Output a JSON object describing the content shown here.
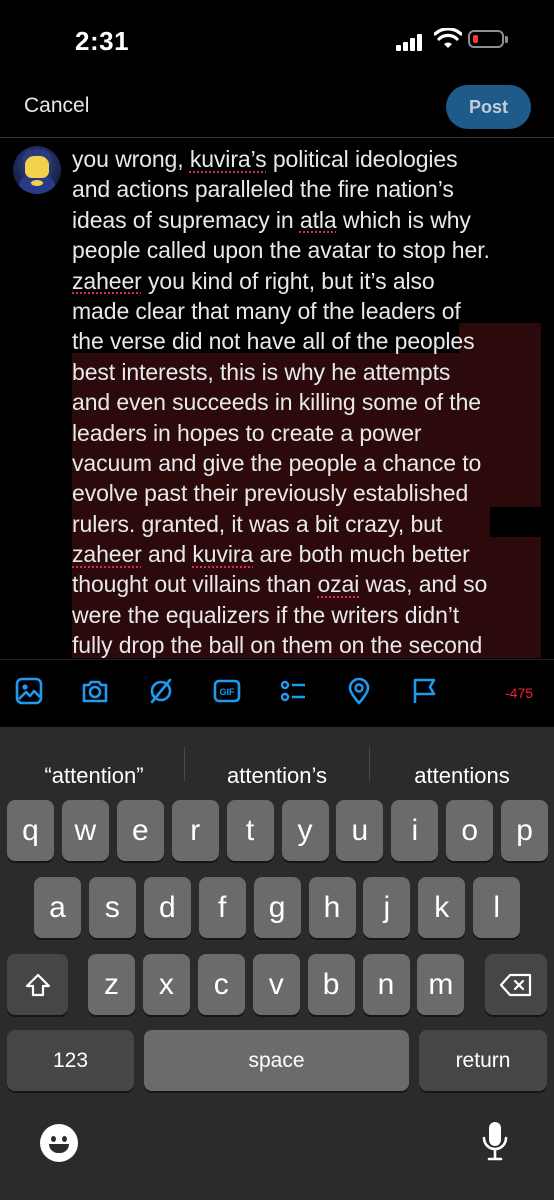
{
  "status_bar": {
    "time": "2:31"
  },
  "header": {
    "cancel_label": "Cancel",
    "post_label": "Post"
  },
  "composer": {
    "text_lines": [
      [
        {
          "t": "you wrong, "
        },
        {
          "t": "kuvira’s",
          "s": 1
        },
        {
          "t": " political ideologies"
        }
      ],
      [
        {
          "t": "and actions paralleled the fire nation’s"
        }
      ],
      [
        {
          "t": "ideas of supremacy in "
        },
        {
          "t": "atla",
          "s": 1
        },
        {
          "t": " which is why"
        }
      ],
      [
        {
          "t": "people called upon the avatar to stop her."
        }
      ],
      [
        {
          "t": "zaheer",
          "s": 1
        },
        {
          "t": " you kind of right, but it’s also"
        }
      ],
      [
        {
          "t": "made clear that many of the leaders of"
        }
      ],
      [
        {
          "t": "the verse did not have all of the peoples"
        }
      ],
      [
        {
          "t": "best interests, this is why he attempts"
        }
      ],
      [
        {
          "t": "and even succeeds in killing some of the"
        }
      ],
      [
        {
          "t": "leaders in hopes to create a power"
        }
      ],
      [
        {
          "t": "vacuum and give the people a chance to"
        }
      ],
      [
        {
          "t": "evolve past their previously established"
        }
      ],
      [
        {
          "t": "rulers. granted, it was a bit crazy, but"
        }
      ],
      [
        {
          "t": "zaheer",
          "s": 1
        },
        {
          "t": " and "
        },
        {
          "t": "kuvira",
          "s": 1
        },
        {
          "t": " are both much better"
        }
      ],
      [
        {
          "t": "thought out villains than "
        },
        {
          "t": "ozai",
          "s": 1
        },
        {
          "t": " was, and so"
        }
      ],
      [
        {
          "t": "were the equalizers if the writers didn’t"
        }
      ],
      [
        {
          "t": "fully drop the ball on them on the second"
        }
      ]
    ],
    "char_count": "-475"
  },
  "toolbar": {
    "icons": [
      "image-icon",
      "camera-icon",
      "gif-icon-slash",
      "gif-icon",
      "poll-icon",
      "location-icon",
      "flag-icon"
    ],
    "gif_label": "GIF"
  },
  "keyboard": {
    "suggestions": [
      "“attention”",
      "attention’s",
      "attentions"
    ],
    "row1": [
      "q",
      "w",
      "e",
      "r",
      "t",
      "y",
      "u",
      "i",
      "o",
      "p"
    ],
    "row2": [
      "a",
      "s",
      "d",
      "f",
      "g",
      "h",
      "j",
      "k",
      "l"
    ],
    "row3": [
      "z",
      "x",
      "c",
      "v",
      "b",
      "n",
      "m"
    ],
    "numbers_label": "123",
    "space_label": "space",
    "return_label": "return"
  },
  "colors": {
    "accent": "#1d9bf0",
    "post_button": "#1e5a8a",
    "over_limit": "#f4212e",
    "highlight": "#2c0a0b"
  }
}
